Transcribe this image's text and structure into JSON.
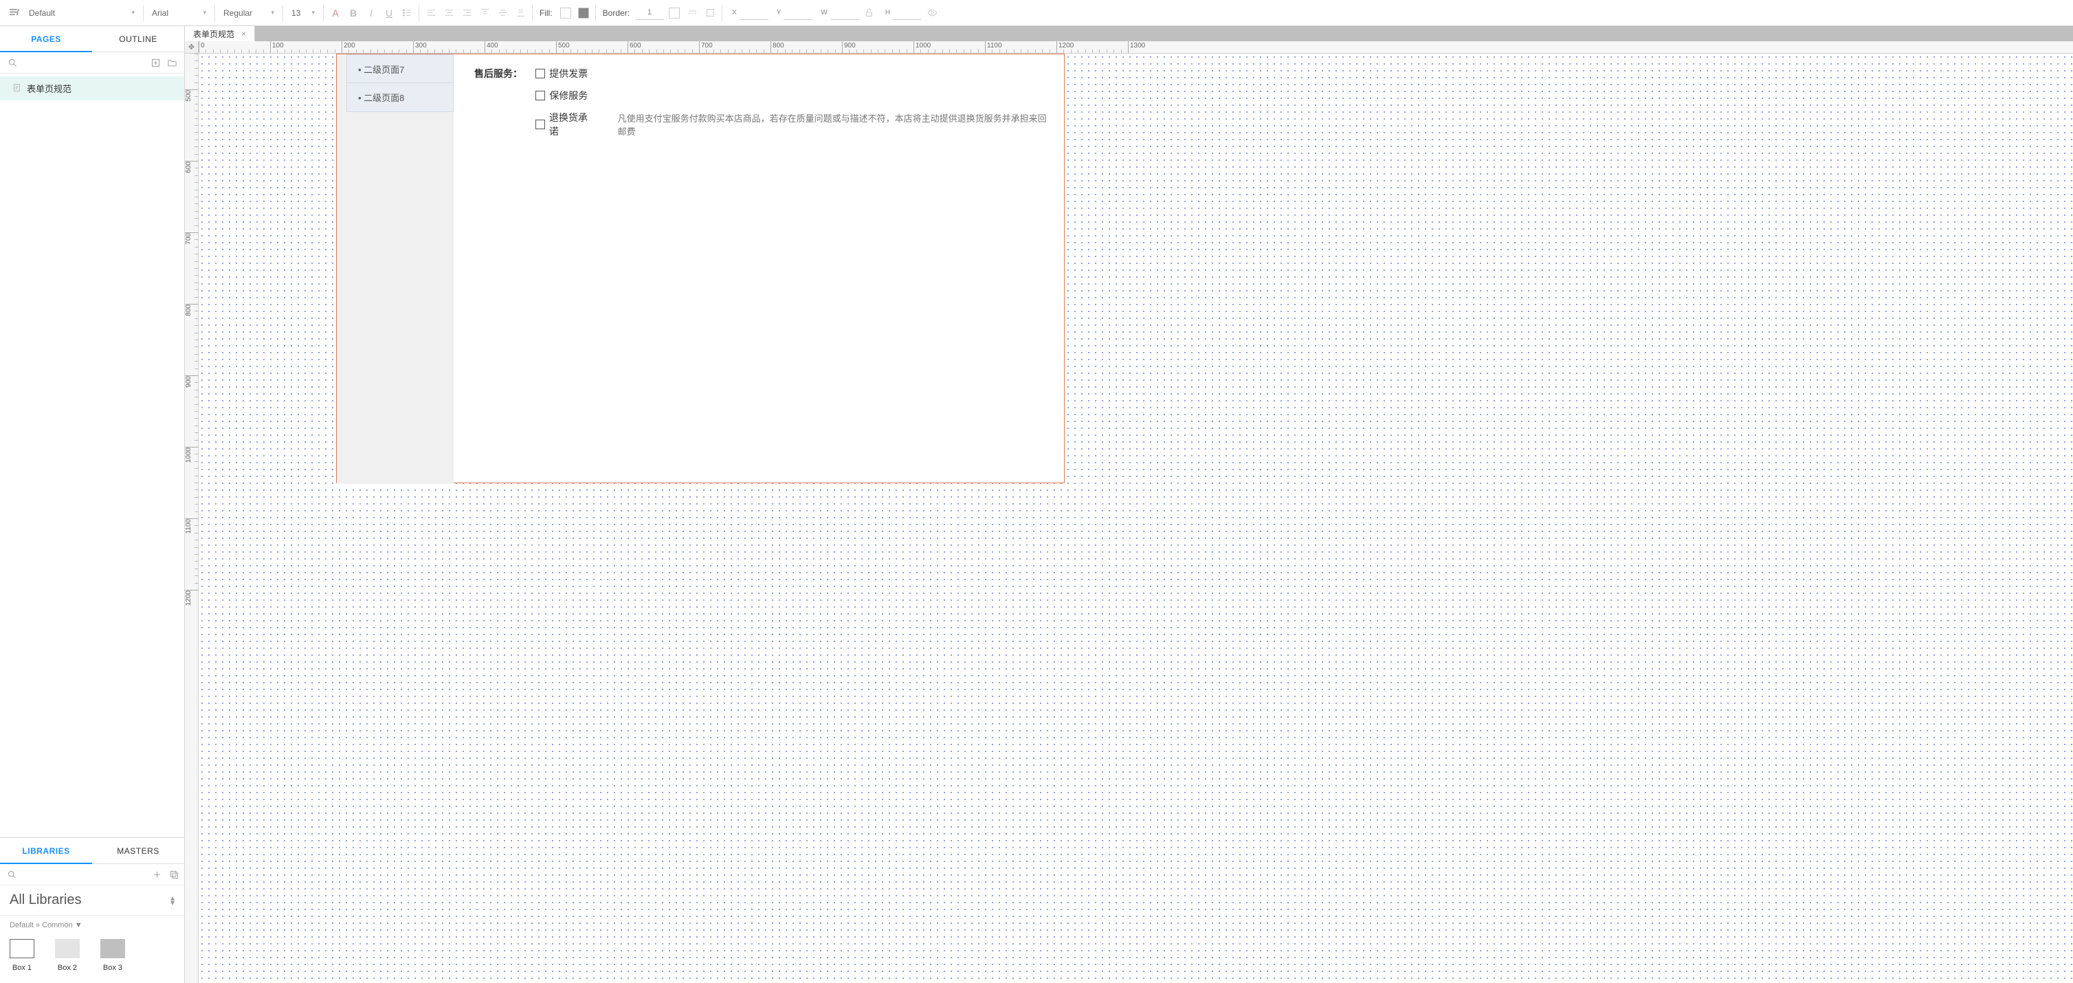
{
  "toolbar": {
    "style": "Default",
    "font": "Arial",
    "weight": "Regular",
    "size": "13",
    "fill_label": "Fill:",
    "border_label": "Border:",
    "border_width": "1",
    "x_label": "X",
    "y_label": "Y",
    "w_label": "W",
    "h_label": "H"
  },
  "sidebar": {
    "tabs": {
      "pages": "PAGES",
      "outline": "OUTLINE"
    },
    "pages": [
      {
        "name": "表单页规范"
      }
    ]
  },
  "libraries": {
    "tabs": {
      "libraries": "LIBRARIES",
      "masters": "MASTERS"
    },
    "title": "All Libraries",
    "path": "Default » Common ▼",
    "items": [
      {
        "label": "Box 1",
        "cls": "box1"
      },
      {
        "label": "Box 2",
        "cls": "box2"
      },
      {
        "label": "Box 3",
        "cls": "box3"
      }
    ]
  },
  "document": {
    "tab_name": "表单页规范"
  },
  "ruler": {
    "h_start": 0,
    "h_end": 1300,
    "h_step_major": 100,
    "h_step_minor": 10,
    "v_start": 450,
    "v_end": 1200,
    "v_step_major": 100,
    "v_step_minor": 10
  },
  "artboard": {
    "nav": [
      "二级页面7",
      "二级页面8"
    ],
    "form": {
      "label": "售后服务：",
      "checks": [
        {
          "label": "提供发票",
          "desc": ""
        },
        {
          "label": "保修服务",
          "desc": ""
        },
        {
          "label": "退换货承诺",
          "desc": "凡使用支付宝服务付款购买本店商品，若存在质量问题或与描述不符，本店将主动提供退换货服务并承担来回邮费"
        }
      ]
    }
  }
}
